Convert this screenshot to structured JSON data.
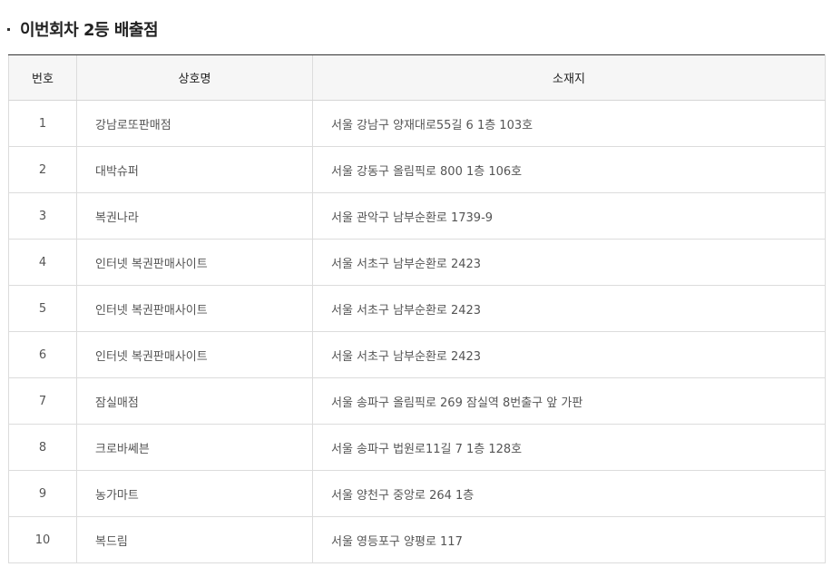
{
  "section": {
    "title": "이번회차 2등 배출점"
  },
  "table": {
    "headers": {
      "number": "번호",
      "name": "상호명",
      "address": "소재지"
    },
    "rows": [
      {
        "number": "1",
        "name": "강남로또판매점",
        "address": "서울 강남구 양재대로55길 6 1층 103호"
      },
      {
        "number": "2",
        "name": "대박슈퍼",
        "address": "서울 강동구 올림픽로 800 1층 106호"
      },
      {
        "number": "3",
        "name": "복권나라",
        "address": "서울 관악구 남부순환로 1739-9"
      },
      {
        "number": "4",
        "name": "인터넷 복권판매사이트",
        "address": "서울 서초구 남부순환로 2423"
      },
      {
        "number": "5",
        "name": "인터넷 복권판매사이트",
        "address": "서울 서초구 남부순환로 2423"
      },
      {
        "number": "6",
        "name": "인터넷 복권판매사이트",
        "address": "서울 서초구 남부순환로 2423"
      },
      {
        "number": "7",
        "name": "잠실매점",
        "address": "서울 송파구 올림픽로 269 잠실역 8번출구 앞 가판"
      },
      {
        "number": "8",
        "name": "크로바쎄븐",
        "address": "서울 송파구 법원로11길 7 1층 128호"
      },
      {
        "number": "9",
        "name": "농가마트",
        "address": "서울 양천구 중앙로 264 1층"
      },
      {
        "number": "10",
        "name": "복드림",
        "address": "서울 영등포구 양평로 117"
      }
    ]
  }
}
